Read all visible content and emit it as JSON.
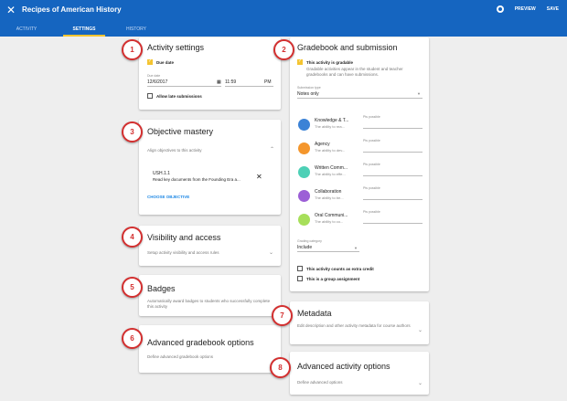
{
  "header": {
    "title": "Recipes of American History",
    "preview_label": "PREVIEW",
    "save_label": "SAVE"
  },
  "tabs": [
    {
      "label": "ACTIVITY"
    },
    {
      "label": "SETTINGS",
      "active": true
    },
    {
      "label": "HISTORY"
    }
  ],
  "activity_settings": {
    "badge": "1",
    "title": "Activity settings",
    "due_date_checkbox_label": "Due date",
    "due_date_label": "Due date",
    "date_value": "12/6/2017",
    "time_value": "11:59",
    "ampm_value": "PM",
    "late_label": "Allow late submissions"
  },
  "objective_mastery": {
    "badge": "3",
    "title": "Objective mastery",
    "subtitle": "Align objectives to this activity",
    "objective_code": "USH.1.1",
    "objective_text": "Read key documents from the Founding Era a...",
    "choose_label": "CHOOSE OBJECTIVE"
  },
  "visibility": {
    "badge": "4",
    "title": "Visibility and access",
    "subtitle": "Setup activity visibility and access rules"
  },
  "badges": {
    "badge": "5",
    "title": "Badges",
    "subtitle": "Automatically award badges to students who successfully complete this activity"
  },
  "advanced_gradebook": {
    "badge": "6",
    "title": "Advanced gradebook options",
    "subtitle": "Define advanced gradebook options"
  },
  "gradebook": {
    "badge": "2",
    "title": "Gradebook and submission",
    "gradable_label": "This activity is gradable",
    "gradable_desc": "Gradable activities appear in the student and teacher gradebooks and can have submissions.",
    "submission_type_label": "Submission type",
    "submission_type_value": "Notes only",
    "pts_label": "Pts possible",
    "objectives": [
      {
        "name": "Knowledge & T...",
        "desc": "The ability to rea...",
        "color": "#3b82d6"
      },
      {
        "name": "Agency",
        "desc": "The ability to dev...",
        "color": "#f4962c"
      },
      {
        "name": "Written Comm...",
        "desc": "The ability to effe...",
        "color": "#4dd0b6"
      },
      {
        "name": "Collaboration",
        "desc": "The ability to be...",
        "color": "#9c5fd6"
      },
      {
        "name": "Oral Communi...",
        "desc": "The ability to co...",
        "color": "#a7df5a"
      }
    ],
    "grading_category_label": "Grading category",
    "grading_category_value": "Include",
    "extra_credit_label": "This activity counts as extra credit",
    "group_label": "This is a group assignment"
  },
  "metadata": {
    "badge": "7",
    "title": "Metadata",
    "subtitle": "Edit description and other activity metadata for course authors"
  },
  "advanced_activity": {
    "badge": "8",
    "title": "Advanced activity options",
    "subtitle": "Define advanced options"
  },
  "colors": {
    "header_bg": "#1565c0",
    "active_tab_underline": "#f4c430",
    "checkbox_checked": "#f4c430",
    "badge_red": "#d32f2f",
    "link_blue": "#1e88e5"
  }
}
